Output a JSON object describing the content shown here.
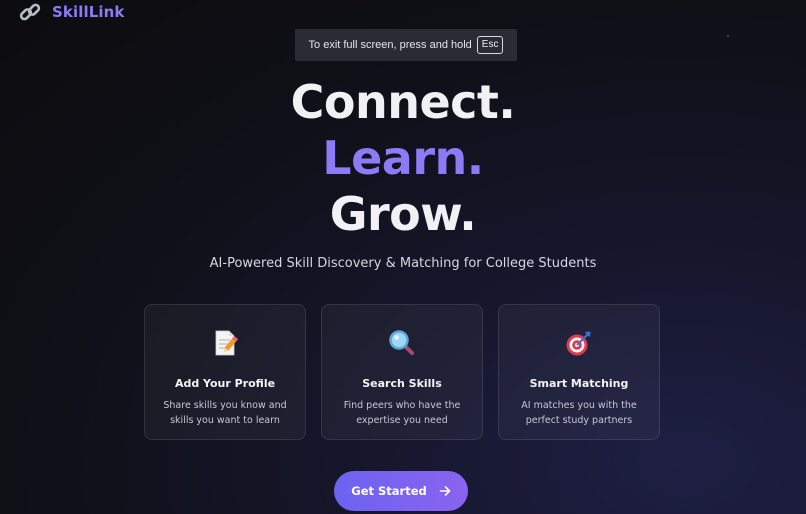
{
  "brand": {
    "name": "SkillLink",
    "icon": "link-icon"
  },
  "fullscreen_notice": {
    "text": "To exit full screen, press and hold",
    "key": "Esc"
  },
  "hero": {
    "line1": "Connect.",
    "line2": "Learn.",
    "line3": "Grow."
  },
  "subtitle": "AI-Powered Skill Discovery & Matching for College Students",
  "cards": [
    {
      "icon": "memo-icon",
      "title": "Add Your Profile",
      "description": "Share skills you know and skills you want to learn"
    },
    {
      "icon": "magnifier-icon",
      "title": "Search Skills",
      "description": "Find peers who have the expertise you need"
    },
    {
      "icon": "target-icon",
      "title": "Smart Matching",
      "description": "AI matches you with the perfect study partners"
    }
  ],
  "cta": {
    "label": "Get Started",
    "icon": "arrow-right-icon"
  },
  "colors": {
    "accent": "#8b7cf6",
    "button_start": "#6c63f1",
    "button_end": "#8a63ef",
    "background": "#0f0f16"
  }
}
